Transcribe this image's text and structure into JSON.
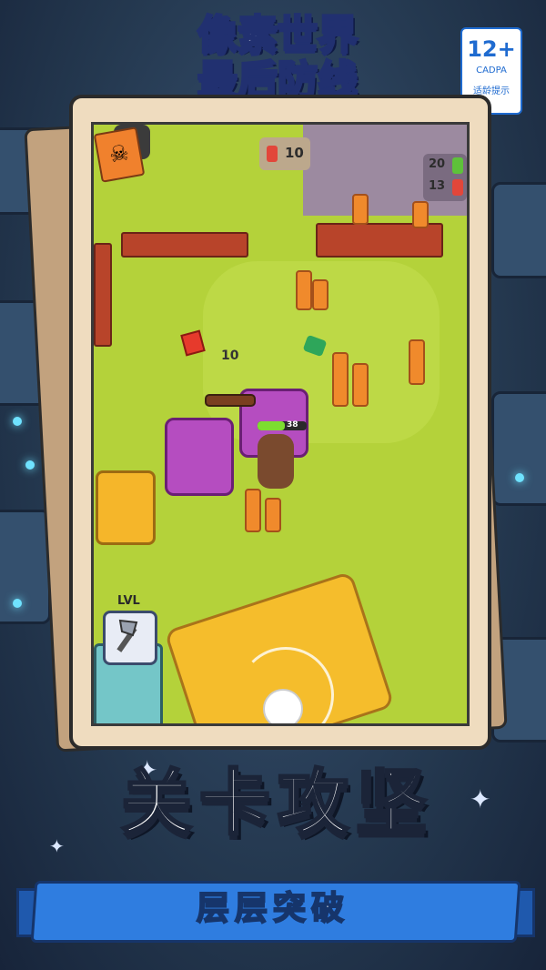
{
  "game_title": {
    "line1": "像素世界",
    "line2": "最后防线"
  },
  "age_rating": {
    "value": "12+",
    "org": "CADPA",
    "tip": "适龄提示"
  },
  "hud": {
    "top_counter": "10",
    "resources": [
      {
        "value": "20",
        "color": "#5ec23a"
      },
      {
        "value": "13",
        "color": "#e2463a"
      }
    ],
    "damage_text": "10",
    "player_hp": "38",
    "level_button_label": "LVL"
  },
  "headline": "关卡攻坚",
  "ribbon_text": "层层突破",
  "colors": {
    "accent_blue": "#2f7de0",
    "title_yellow": "#ffe35a",
    "grass": "#b4d23a"
  },
  "icons": {
    "skull": "☠",
    "axe": "axe-icon",
    "search": "search-icon"
  }
}
